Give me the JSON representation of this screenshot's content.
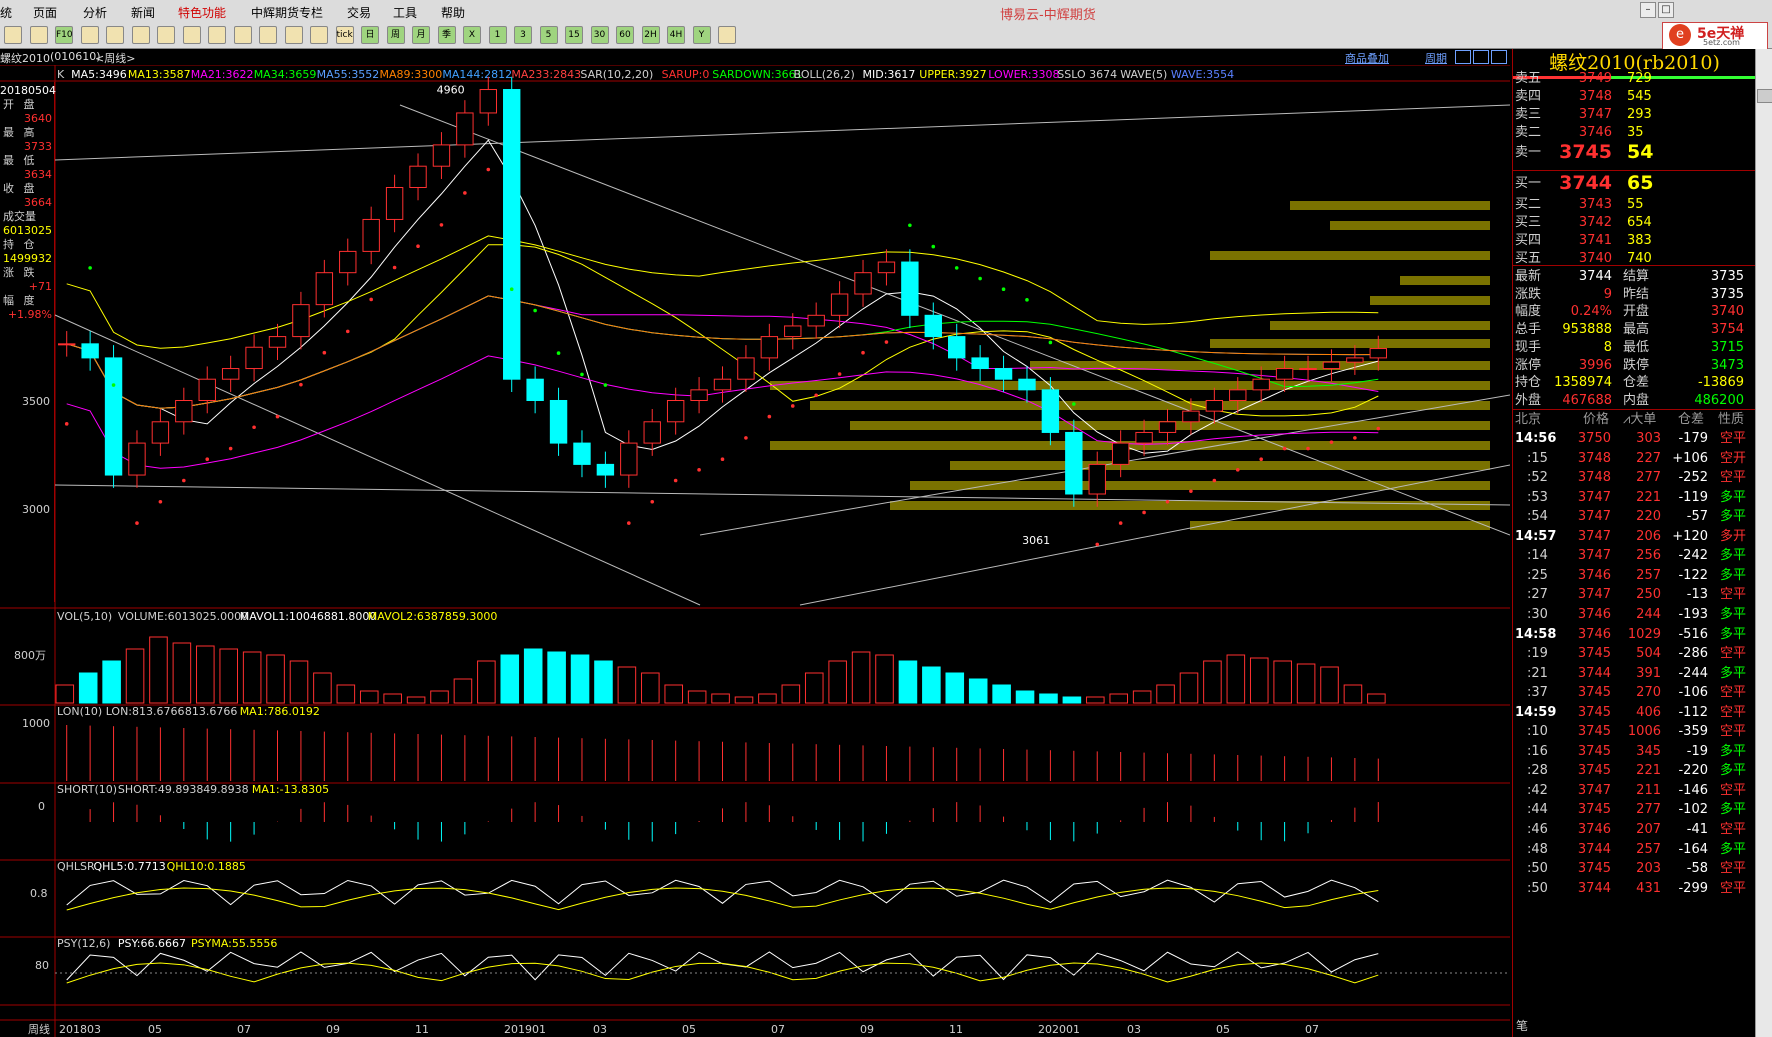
{
  "app": {
    "title": "博易云-中辉期货",
    "logo_text": "5e天禅",
    "logo_url": "5etz.com"
  },
  "menu": [
    "统",
    "页面",
    "分析",
    "新闻",
    "特色功能",
    "中辉期货专栏",
    "交易",
    "工具",
    "帮助"
  ],
  "toolbar_icons": [
    "home-icon",
    "stack-icon",
    "F10",
    "refresh-icon",
    "search-icon",
    "search2-icon",
    "window-icon",
    "pen-icon",
    "dollar-icon",
    "filter-icon",
    "new-icon",
    "list-icon",
    "chart-icon",
    "tick",
    "日",
    "周",
    "月",
    "季",
    "X",
    "1",
    "3",
    "5",
    "15",
    "30",
    "60",
    "2H",
    "4H",
    "Y",
    "calc-icon"
  ],
  "chart": {
    "symbol_label": "螺纹2010",
    "symbol_code": "(010610)",
    "period": "<周线>",
    "overlay_btn": "商品叠加",
    "period_btn": "周期",
    "indicators": [
      {
        "t": "K",
        "c": "#d0d0d0"
      },
      {
        "t": "MA5:3496",
        "c": "#ffffff"
      },
      {
        "t": "MA13:3587",
        "c": "#ffff00"
      },
      {
        "t": "MA21:3622",
        "c": "#ff00ff"
      },
      {
        "t": "MA34:3659",
        "c": "#00ff00"
      },
      {
        "t": "MA55:3552",
        "c": "#5aa0ff"
      },
      {
        "t": "MA89:3300",
        "c": "#ff8000"
      },
      {
        "t": "MA144:2812",
        "c": "#40a0ff"
      },
      {
        "t": "MA233:2843",
        "c": "#ff4040"
      },
      {
        "t": "SAR(10,2,20)",
        "c": "#d0d0d0"
      },
      {
        "t": "SARUP:0",
        "c": "#ff3030"
      },
      {
        "t": "SARDOWN:3661",
        "c": "#00ff00"
      },
      {
        "t": "BOLL(26,2)",
        "c": "#d0d0d0"
      },
      {
        "t": "MID:3617",
        "c": "#ffffff"
      },
      {
        "t": "UPPER:3927",
        "c": "#ffff00"
      },
      {
        "t": "LOWER:3308",
        "c": "#ff00ff"
      },
      {
        "t": "SSLO 3674",
        "c": "#d0d0d0"
      },
      {
        "t": "WAVE(5)",
        "c": "#d0d0d0"
      },
      {
        "t": "WAVE:3554",
        "c": "#5a80ff"
      }
    ],
    "price_axis": [
      "3500",
      "3000"
    ],
    "high_mark": "4960",
    "low_mark": "3061",
    "left_info": {
      "date": "20180504",
      "open_label": "开 盘",
      "open": "3640",
      "high_label": "最 高",
      "high": "3733",
      "low_label": "最 低",
      "low": "3634",
      "close_label": "收 盘",
      "close": "3664",
      "vol_label": "成交量",
      "vol": "6013025",
      "oi_label": "持 仓",
      "oi": "1499932",
      "chg_label": "涨 跌",
      "chg": "+71",
      "pct_label": "幅 度",
      "pct": "+1.98%"
    },
    "vol_panel": {
      "label": "VOL(5,10)",
      "items": [
        {
          "t": "VOLUME:6013025.0000",
          "c": "#d0d0d0"
        },
        {
          "t": "MAVOL1:10046881.8000",
          "c": "#ffffff"
        },
        {
          "t": "MAVOL2:6387859.3000",
          "c": "#ffff00"
        }
      ],
      "axis": "800万"
    },
    "lon_panel": {
      "items": [
        {
          "t": "LON(10)",
          "c": "#d0d0d0"
        },
        {
          "t": "LON:813.6766",
          "c": "#d0d0d0"
        },
        {
          "t": "813.6766",
          "c": "#d0d0d0"
        },
        {
          "t": "MA1:786.0192",
          "c": "#ffff00"
        }
      ],
      "axis": "1000"
    },
    "short_panel": {
      "items": [
        {
          "t": "SHORT(10)",
          "c": "#d0d0d0"
        },
        {
          "t": "SHORT:49.8938",
          "c": "#d0d0d0"
        },
        {
          "t": "49.8938",
          "c": "#d0d0d0"
        },
        {
          "t": "MA1:-13.8305",
          "c": "#ffff00"
        }
      ],
      "axis": "0"
    },
    "qhl_panel": {
      "items": [
        {
          "t": "QHLSR",
          "c": "#d0d0d0"
        },
        {
          "t": "QHL5:0.7713",
          "c": "#ffffff"
        },
        {
          "t": "QHL10:0.1885",
          "c": "#ffff00"
        }
      ],
      "axis": "0.8"
    },
    "psy_panel": {
      "items": [
        {
          "t": "PSY(12,6)",
          "c": "#d0d0d0"
        },
        {
          "t": "PSY:66.6667",
          "c": "#ffffff"
        },
        {
          "t": "PSYMA:55.5556",
          "c": "#ffff00"
        }
      ],
      "axis": "80"
    },
    "x_labels": [
      "201803",
      "05",
      "07",
      "09",
      "11",
      "201901",
      "03",
      "05",
      "07",
      "09",
      "11",
      "202001",
      "03",
      "05",
      "07"
    ],
    "period_tab": "周线"
  },
  "chart_data": {
    "type": "candlestick",
    "title": "螺纹2010(010610)<周线>",
    "ylim": [
      2600,
      5000
    ],
    "x_labels": [
      "201803",
      "05",
      "07",
      "09",
      "11",
      "201901",
      "03",
      "05",
      "07",
      "09",
      "11",
      "202001",
      "03",
      "05",
      "07"
    ],
    "closes": [
      3766,
      3700,
      3150,
      3300,
      3400,
      3500,
      3600,
      3650,
      3750,
      3800,
      3950,
      4100,
      4200,
      4350,
      4500,
      4600,
      4700,
      4850,
      4960,
      3600,
      3500,
      3300,
      3200,
      3150,
      3300,
      3400,
      3500,
      3550,
      3600,
      3700,
      3800,
      3850,
      3900,
      4000,
      4100,
      4150,
      3900,
      3800,
      3700,
      3650,
      3600,
      3550,
      3350,
      3061,
      3200,
      3300,
      3350,
      3400,
      3450,
      3500,
      3550,
      3600,
      3650,
      3650,
      3680,
      3700,
      3744
    ],
    "volume_wan": [
      300,
      500,
      700,
      900,
      1100,
      1000,
      950,
      900,
      850,
      800,
      700,
      500,
      300,
      200,
      150,
      100,
      200,
      400,
      700,
      800,
      900,
      850,
      800,
      700,
      600,
      500,
      300,
      200,
      150,
      100,
      150,
      300,
      500,
      700,
      850,
      800,
      700,
      600,
      500,
      400,
      300,
      200,
      150,
      100,
      100,
      150,
      200,
      300,
      500,
      700,
      800,
      750,
      700,
      650,
      600,
      300,
      150
    ],
    "panels": [
      "VOL(5,10)",
      "LON(10)",
      "SHORT(10)",
      "QHLSR",
      "PSY(12,6)"
    ]
  },
  "quote": {
    "title": "螺纹2010(rb2010)",
    "asks": [
      {
        "l": "卖五",
        "p": "3749",
        "v": "729"
      },
      {
        "l": "卖四",
        "p": "3748",
        "v": "545"
      },
      {
        "l": "卖三",
        "p": "3747",
        "v": "293"
      },
      {
        "l": "卖二",
        "p": "3746",
        "v": "35"
      },
      {
        "l": "卖一",
        "p": "3745",
        "v": "54"
      }
    ],
    "bids": [
      {
        "l": "买一",
        "p": "3744",
        "v": "65"
      },
      {
        "l": "买二",
        "p": "3743",
        "v": "55"
      },
      {
        "l": "买三",
        "p": "3742",
        "v": "654"
      },
      {
        "l": "买四",
        "p": "3741",
        "v": "383"
      },
      {
        "l": "买五",
        "p": "3740",
        "v": "740"
      }
    ],
    "stats": [
      {
        "l": "最新",
        "v": "3744",
        "l2": "结算",
        "v2": "3735",
        "c": "#ffffff",
        "c2": "#ffffff"
      },
      {
        "l": "涨跌",
        "v": "9",
        "l2": "昨结",
        "v2": "3735",
        "c": "#ff3030",
        "c2": "#ffffff"
      },
      {
        "l": "幅度",
        "v": "0.24%",
        "l2": "开盘",
        "v2": "3740",
        "c": "#ff3030",
        "c2": "#ff3030"
      },
      {
        "l": "总手",
        "v": "953888",
        "l2": "最高",
        "v2": "3754",
        "c": "#ffff00",
        "c2": "#ff3030"
      },
      {
        "l": "现手",
        "v": "8",
        "l2": "最低",
        "v2": "3715",
        "c": "#ffff00",
        "c2": "#00ff00"
      },
      {
        "l": "涨停",
        "v": "3996",
        "l2": "跌停",
        "v2": "3473",
        "c": "#ff3030",
        "c2": "#00ff00"
      },
      {
        "l": "持仓",
        "v": "1358974",
        "l2": "仓差",
        "v2": "-13869",
        "c": "#ffff00",
        "c2": "#ffff00"
      },
      {
        "l": "外盘",
        "v": "467688",
        "l2": "内盘",
        "v2": "486200",
        "c": "#ff3030",
        "c2": "#00ff00"
      }
    ],
    "tick_header": {
      "a": "北京",
      "b": "价格",
      "c": "⩘大单",
      "d": "仓差",
      "e": "性质"
    },
    "ticks": [
      {
        "t": "14:56",
        "p": "3750",
        "v": "303",
        "d": "-179",
        "n": "空平",
        "tb": true
      },
      {
        "t": ":15",
        "p": "3748",
        "v": "227",
        "d": "+106",
        "n": "空开"
      },
      {
        "t": ":52",
        "p": "3748",
        "v": "277",
        "d": "-252",
        "n": "空平"
      },
      {
        "t": ":53",
        "p": "3747",
        "v": "221",
        "d": "-119",
        "n": "多平"
      },
      {
        "t": ":54",
        "p": "3747",
        "v": "220",
        "d": "-57",
        "n": "多平"
      },
      {
        "t": "14:57",
        "p": "3747",
        "v": "206",
        "d": "+120",
        "n": "多开",
        "tb": true
      },
      {
        "t": ":14",
        "p": "3747",
        "v": "256",
        "d": "-242",
        "n": "多平"
      },
      {
        "t": ":25",
        "p": "3746",
        "v": "257",
        "d": "-122",
        "n": "多平"
      },
      {
        "t": ":27",
        "p": "3747",
        "v": "250",
        "d": "-13",
        "n": "空平"
      },
      {
        "t": ":30",
        "p": "3746",
        "v": "244",
        "d": "-193",
        "n": "多平"
      },
      {
        "t": "14:58",
        "p": "3746",
        "v": "1029",
        "d": "-516",
        "n": "多平",
        "tb": true
      },
      {
        "t": ":19",
        "p": "3745",
        "v": "504",
        "d": "-286",
        "n": "空平"
      },
      {
        "t": ":21",
        "p": "3744",
        "v": "391",
        "d": "-244",
        "n": "多平"
      },
      {
        "t": ":37",
        "p": "3745",
        "v": "270",
        "d": "-106",
        "n": "空平"
      },
      {
        "t": "14:59",
        "p": "3745",
        "v": "406",
        "d": "-112",
        "n": "空平",
        "tb": true
      },
      {
        "t": ":10",
        "p": "3745",
        "v": "1006",
        "d": "-359",
        "n": "空平"
      },
      {
        "t": ":16",
        "p": "3745",
        "v": "345",
        "d": "-19",
        "n": "多平"
      },
      {
        "t": ":28",
        "p": "3745",
        "v": "221",
        "d": "-220",
        "n": "多平"
      },
      {
        "t": ":42",
        "p": "3747",
        "v": "211",
        "d": "-146",
        "n": "空平"
      },
      {
        "t": ":44",
        "p": "3745",
        "v": "277",
        "d": "-102",
        "n": "多平"
      },
      {
        "t": ":46",
        "p": "3746",
        "v": "207",
        "d": "-41",
        "n": "空平"
      },
      {
        "t": ":48",
        "p": "3744",
        "v": "257",
        "d": "-164",
        "n": "多平"
      },
      {
        "t": ":50",
        "p": "3745",
        "v": "203",
        "d": "-58",
        "n": "空平"
      },
      {
        "t": ":50",
        "p": "3744",
        "v": "431",
        "d": "-299",
        "n": "空平"
      }
    ],
    "bottom_tab": "笔"
  }
}
